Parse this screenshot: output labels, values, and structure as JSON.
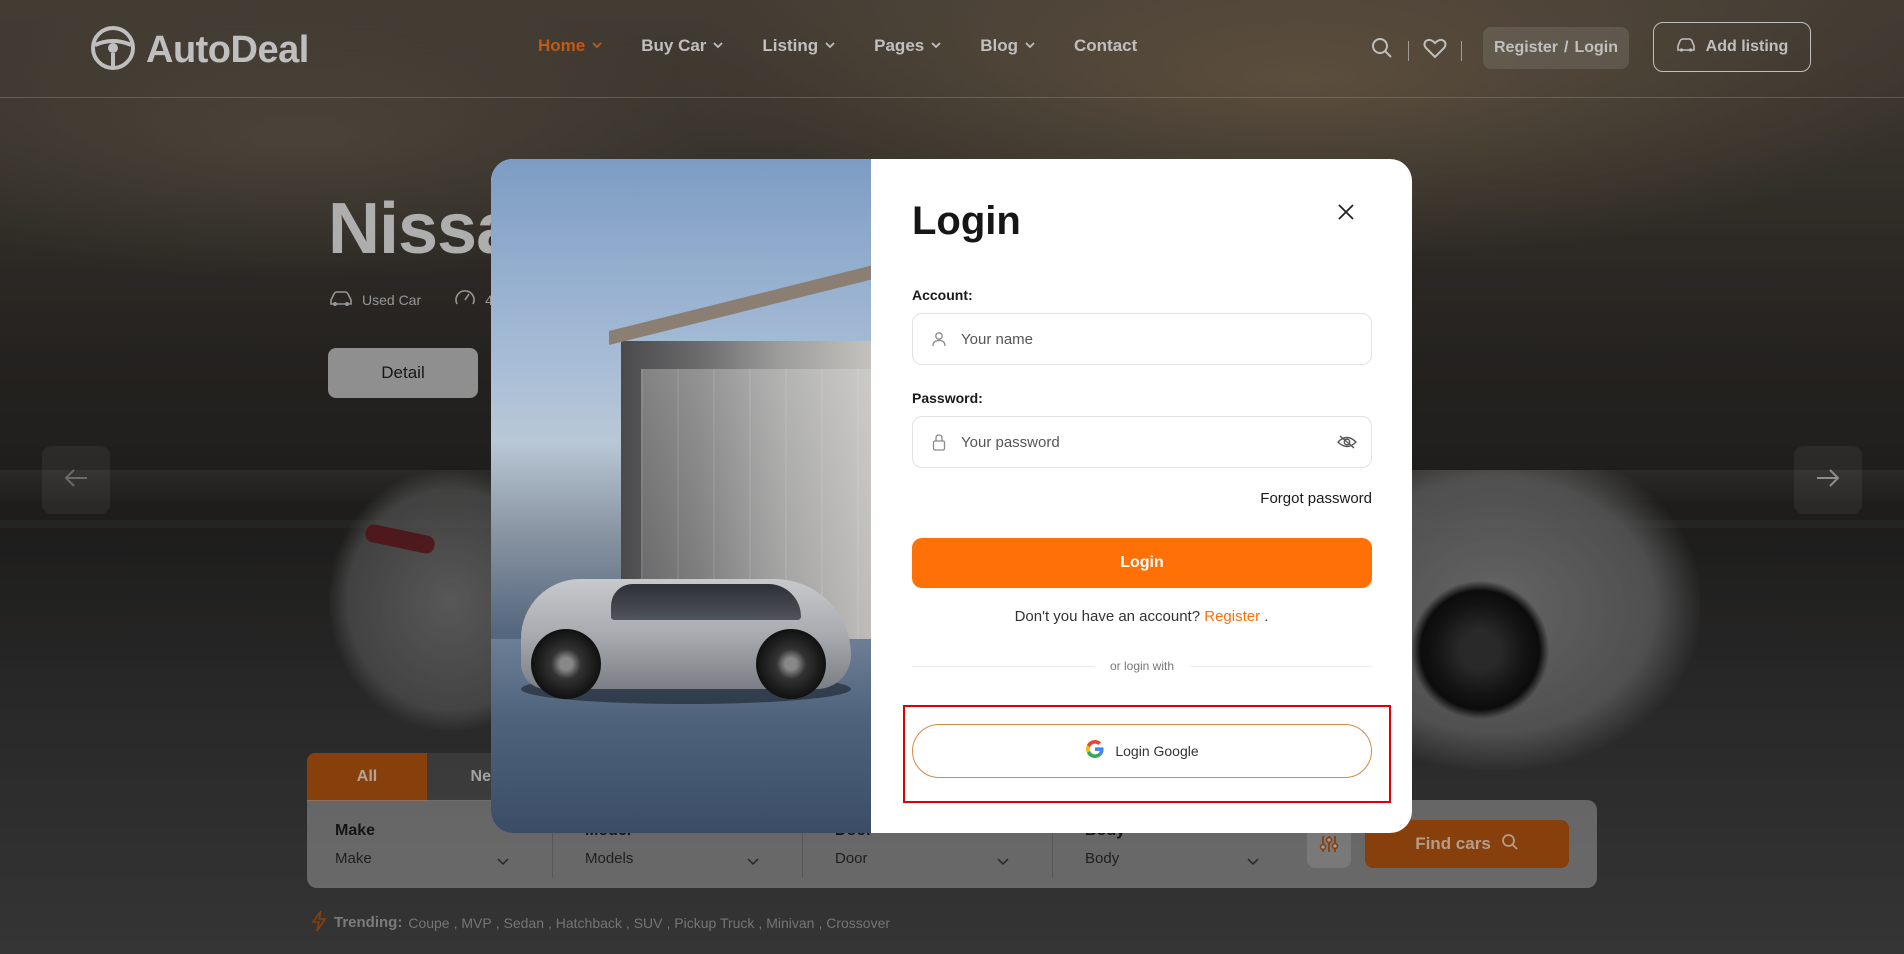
{
  "brand": {
    "name": "AutoDeal"
  },
  "nav": [
    {
      "label": "Home",
      "active": true
    },
    {
      "label": "Buy Car"
    },
    {
      "label": "Listing"
    },
    {
      "label": "Pages"
    },
    {
      "label": "Blog"
    },
    {
      "label": "Contact"
    }
  ],
  "header": {
    "register_label": "Register",
    "register_sep": "/",
    "login_label": "Login",
    "add_listing": "Add listing",
    "icons": [
      "search-icon",
      "heart-icon"
    ]
  },
  "hero": {
    "title": "Nissa",
    "meta": [
      {
        "icon": "car-icon",
        "text": "Used Car"
      },
      {
        "icon": "speedometer-icon",
        "text": "4"
      }
    ],
    "detail_button": "Detail"
  },
  "search": {
    "tabs": [
      "All",
      "New"
    ],
    "fields": [
      {
        "label": "Make",
        "value": "Make"
      },
      {
        "label": "Model",
        "value": "Models"
      },
      {
        "label": "Door",
        "value": "Door"
      },
      {
        "label": "Body",
        "value": "Body"
      }
    ],
    "find_button": "Find cars"
  },
  "trending": {
    "label": "Trending:",
    "items": [
      "Coupe",
      "MVP",
      "Sedan",
      "Hatchback",
      "SUV",
      "Pickup Truck",
      "Minivan",
      "Crossover"
    ]
  },
  "login_modal": {
    "title": "Login",
    "account_label": "Account:",
    "account_placeholder": "Your name",
    "password_label": "Password:",
    "password_placeholder": "Your password",
    "forgot": "Forgot password",
    "login_button": "Login",
    "no_account": "Don't you have an account?",
    "register_link": "Register",
    "register_suffix": ".",
    "divider": "or login with",
    "google_button": "Login Google"
  },
  "colors": {
    "accent": "#ff7006",
    "highlight": "#e00000"
  }
}
